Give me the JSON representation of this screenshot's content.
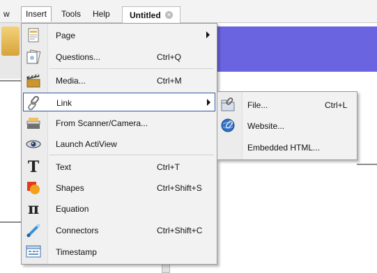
{
  "menubar": {
    "items": [
      {
        "label": "w"
      },
      {
        "label": "Insert"
      },
      {
        "label": "Tools"
      },
      {
        "label": "Help"
      }
    ],
    "document_tab": {
      "label": "Untitled"
    }
  },
  "insert_menu": {
    "items": [
      {
        "label": "Page",
        "shortcut": "",
        "icon": "page-icon",
        "has_submenu": true
      },
      {
        "label": "Questions...",
        "shortcut": "Ctrl+Q",
        "icon": "questions-icon"
      },
      {
        "label": "Media...",
        "shortcut": "Ctrl+M",
        "icon": "media-icon"
      },
      {
        "label": "Link",
        "shortcut": "",
        "icon": "link-icon",
        "has_submenu": true,
        "highlighted": true
      },
      {
        "label": "From Scanner/Camera...",
        "shortcut": "",
        "icon": "scanner-icon"
      },
      {
        "label": "Launch ActiView",
        "shortcut": "",
        "icon": "actiview-icon"
      },
      {
        "label": "Text",
        "shortcut": "Ctrl+T",
        "icon": "text-icon"
      },
      {
        "label": "Shapes",
        "shortcut": "Ctrl+Shift+S",
        "icon": "shapes-icon"
      },
      {
        "label": "Equation",
        "shortcut": "",
        "icon": "equation-icon"
      },
      {
        "label": "Connectors",
        "shortcut": "Ctrl+Shift+C",
        "icon": "connectors-icon"
      },
      {
        "label": "Timestamp",
        "shortcut": "",
        "icon": "timestamp-icon"
      }
    ]
  },
  "link_submenu": {
    "items": [
      {
        "label": "File...",
        "shortcut": "Ctrl+L",
        "icon": "file-link-icon"
      },
      {
        "label": "Website...",
        "shortcut": "",
        "icon": "website-icon"
      },
      {
        "label": "Embedded HTML...",
        "shortcut": "",
        "icon": ""
      }
    ]
  },
  "colors": {
    "highlight_border": "#2e55a0",
    "canvas_accent": "#6a64e0",
    "menu_background": "#f2f2f2"
  }
}
